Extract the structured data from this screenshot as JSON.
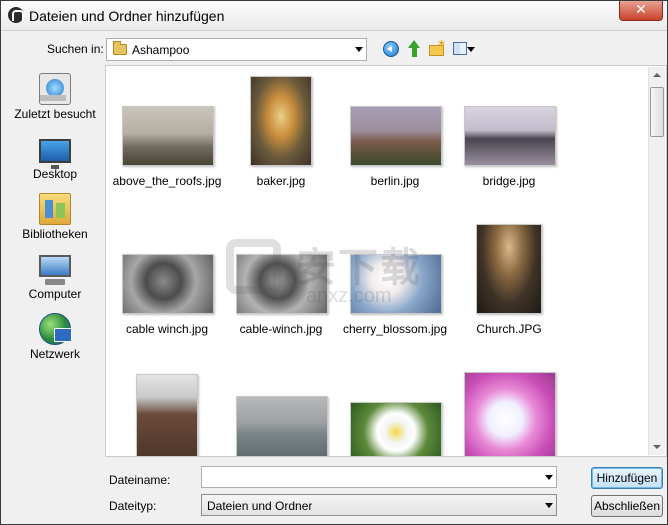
{
  "window": {
    "title": "Dateien und Ordner hinzufügen",
    "close_symbol": "✕"
  },
  "toolbar": {
    "look_in_label": "Suchen in:",
    "look_in_value": "Ashampoo",
    "icons": [
      "back-icon",
      "up-folder-icon",
      "new-folder-icon",
      "view-menu-icon"
    ]
  },
  "places": [
    {
      "label": "Zuletzt besucht",
      "icon": "recent-places-icon"
    },
    {
      "label": "Desktop",
      "icon": "desktop-icon"
    },
    {
      "label": "Bibliotheken",
      "icon": "libraries-icon"
    },
    {
      "label": "Computer",
      "icon": "computer-icon"
    },
    {
      "label": "Netzwerk",
      "icon": "network-icon"
    }
  ],
  "files": [
    {
      "name": "above_the_roofs.jpg"
    },
    {
      "name": "baker.jpg"
    },
    {
      "name": "berlin.jpg"
    },
    {
      "name": "bridge.jpg"
    },
    {
      "name": "cable winch.jpg"
    },
    {
      "name": "cable-winch.jpg"
    },
    {
      "name": "cherry_blossom.jpg"
    },
    {
      "name": "Church.JPG"
    },
    {
      "name": ""
    },
    {
      "name": ""
    },
    {
      "name": ""
    },
    {
      "name": ""
    }
  ],
  "footer": {
    "filename_label": "Dateiname:",
    "filename_value": "",
    "filetype_label": "Dateityp:",
    "filetype_value": "Dateien und Ordner",
    "add_button": "Hinzufügen",
    "cancel_button": "Abschließen"
  },
  "watermark": {
    "text": "安下载",
    "sub": "anxz.com"
  }
}
